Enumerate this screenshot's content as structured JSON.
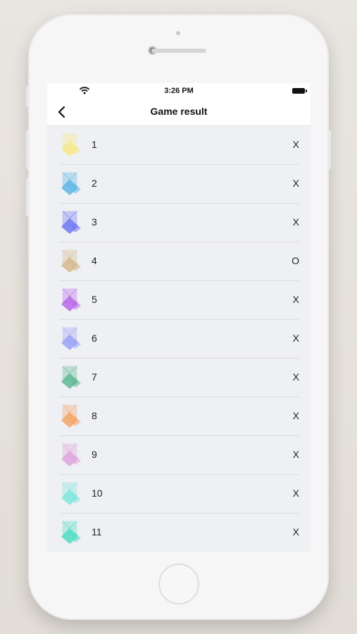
{
  "status_bar": {
    "time": "3:26 PM",
    "wifi_icon": "wifi-icon",
    "battery_icon": "battery-icon"
  },
  "nav": {
    "title": "Game result",
    "back_icon": "chevron-left-icon"
  },
  "results": [
    {
      "number": "1",
      "result": "X",
      "color": "#f5e98a"
    },
    {
      "number": "2",
      "result": "X",
      "color": "#5fb6e6"
    },
    {
      "number": "3",
      "result": "X",
      "color": "#6f79f2"
    },
    {
      "number": "4",
      "result": "O",
      "color": "#d6b98e"
    },
    {
      "number": "5",
      "result": "X",
      "color": "#b969e6"
    },
    {
      "number": "6",
      "result": "X",
      "color": "#9aa2f6"
    },
    {
      "number": "7",
      "result": "X",
      "color": "#5fb894"
    },
    {
      "number": "8",
      "result": "X",
      "color": "#f4a467"
    },
    {
      "number": "9",
      "result": "X",
      "color": "#dea6dc"
    },
    {
      "number": "10",
      "result": "X",
      "color": "#7fe6dc"
    },
    {
      "number": "11",
      "result": "X",
      "color": "#52dcc2"
    }
  ]
}
